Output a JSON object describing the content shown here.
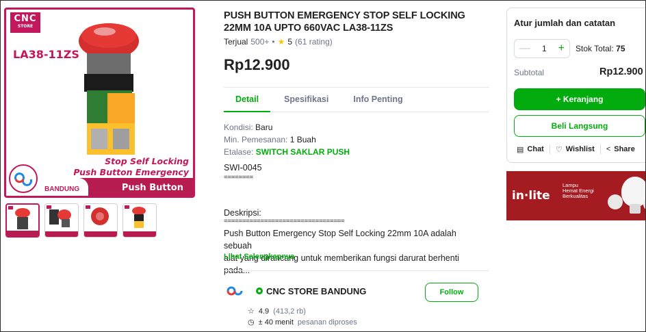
{
  "gallery": {
    "logo_line1": "CNC",
    "logo_line2": "STORE",
    "model_code": "LA38-11ZS",
    "caption_line1": "Stop Self Locking",
    "caption_line2": "Push Button Emergency",
    "city": "BANDUNG",
    "push_label": "Push Button",
    "thumbnail_count": 4,
    "accent_color": "#c2185b"
  },
  "product": {
    "title_line1": "PUSH BUTTON EMERGENCY STOP SELF LOCKING",
    "title_line2": "22MM 10A UPTO 660VAC LA38-11ZS",
    "sold_label": "Terjual",
    "sold_value": "500+",
    "rating": "5",
    "rating_count": "(61 rating)",
    "price": "Rp12.900"
  },
  "tabs": [
    {
      "label": "Detail",
      "active": true
    },
    {
      "label": "Spesifikasi",
      "active": false
    },
    {
      "label": "Info Penting",
      "active": false
    }
  ],
  "details": {
    "condition_label": "Kondisi:",
    "condition_value": "Baru",
    "min_order_label": "Min. Pemesanan:",
    "min_order_value": "1 Buah",
    "showcase_label": "Etalase:",
    "showcase_value": "SWITCH SAKLAR PUSH",
    "sku": "SWI-0045",
    "separator_short": "========",
    "description_heading": "Deskripsi:",
    "separator_long": "=================================",
    "description_line1": "Push Button Emergency Stop Self Locking 22mm 10A adalah sebuah",
    "description_line2": "alat yang dirancang untuk memberikan fungsi darurat berhenti pada...",
    "read_more": "Lihat Selengkapnya"
  },
  "store": {
    "name": "CNC STORE BANDUNG",
    "follow_label": "Follow",
    "rating": "4.9",
    "rating_count": "(413,2 rb)",
    "process_time": "± 40 menit",
    "process_label": "pesanan diproses"
  },
  "purchase_card": {
    "title": "Atur jumlah dan catatan",
    "quantity": "1",
    "minus": "—",
    "plus": "+",
    "stock_label": "Stok Total:",
    "stock_value": "75",
    "subtotal_label": "Subtotal",
    "subtotal_value": "Rp12.900",
    "cart_label": "+ Keranjang",
    "buy_label": "Beli Langsung",
    "chat_label": "Chat",
    "wishlist_label": "Wishlist",
    "share_label": "Share",
    "primary_color": "#03ac0e"
  },
  "banner": {
    "brand": "in·lite",
    "tag_line1": "Lampu",
    "tag_line2": "Hemat Energi",
    "tag_line3": "Berkualitas",
    "color": "#a41c22"
  }
}
